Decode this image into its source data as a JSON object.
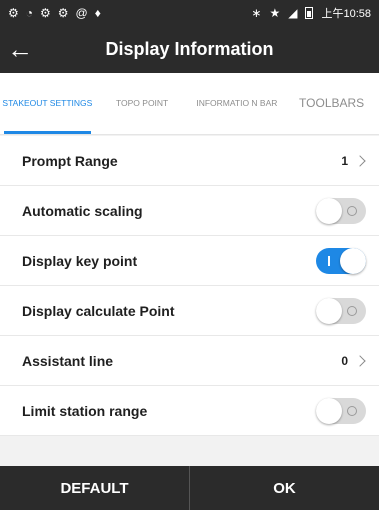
{
  "status_bar": {
    "time": "上午10:58"
  },
  "header": {
    "title": "Display Information"
  },
  "tabs": [
    {
      "label": "STAKEOUT SETTINGS",
      "active": true
    },
    {
      "label": "TOPO POINT",
      "active": false
    },
    {
      "label": "INFORMATIO N BAR",
      "active": false
    },
    {
      "label": "TOOLBARS",
      "active": false
    }
  ],
  "settings": [
    {
      "label": "Prompt Range",
      "type": "value",
      "value": "1"
    },
    {
      "label": "Automatic scaling",
      "type": "toggle",
      "on": false
    },
    {
      "label": "Display key point",
      "type": "toggle",
      "on": true
    },
    {
      "label": "Display calculate Point",
      "type": "toggle",
      "on": false
    },
    {
      "label": "Assistant line",
      "type": "value",
      "value": "0"
    },
    {
      "label": "Limit station range",
      "type": "toggle",
      "on": false
    }
  ],
  "footer": {
    "default_label": "DEFAULT",
    "ok_label": "OK"
  },
  "colors": {
    "accent": "#1e88e5",
    "bar": "#2b2b2b"
  }
}
